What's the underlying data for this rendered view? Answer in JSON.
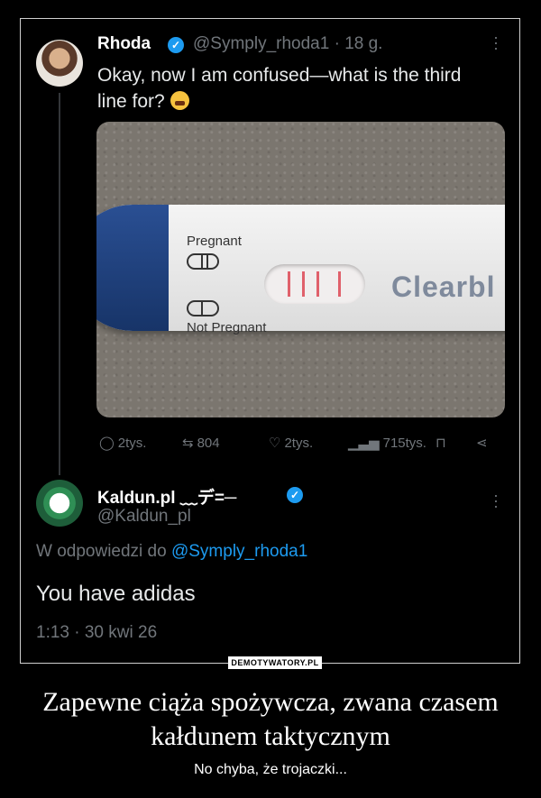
{
  "tweet": {
    "author_name": "Rhoda",
    "handle_time": "@Symply_rhoda1 · 18 g.",
    "text": "Okay, now I am confused—what is the third line for?",
    "image_text": {
      "top_label": "Pregnant",
      "bottom_label": "Not Pregnant",
      "brand": "Clearbl"
    },
    "actions": {
      "replies": "2tys.",
      "reposts": "804",
      "likes": "2tys.",
      "views": "715tys."
    }
  },
  "reply": {
    "author_name": "Kaldun.pl ﹏デ=─",
    "handle": "@Kaldun_pl",
    "replying_to_prefix": "W odpowiedzi do ",
    "replying_to_handle": "@Symply_rhoda1",
    "text": "You have adidas",
    "meta": "1:13 · 30 kwi 26"
  },
  "watermark": "DEMOTYWATORY.PL",
  "caption": {
    "title": "Zapewne ciąża spożywcza, zwana czasem kałdunem taktycznym",
    "subtitle": "No chyba, że trojaczki..."
  },
  "colors": {
    "background": "#000000",
    "verified": "#1d9bf0",
    "link": "#1d9bf0",
    "muted": "#71767b",
    "test_lines": "#e0606b"
  },
  "icons": [
    "verified-icon",
    "more-icon",
    "reply-icon",
    "repost-icon",
    "like-icon",
    "views-icon",
    "bookmark-icon",
    "share-icon"
  ]
}
